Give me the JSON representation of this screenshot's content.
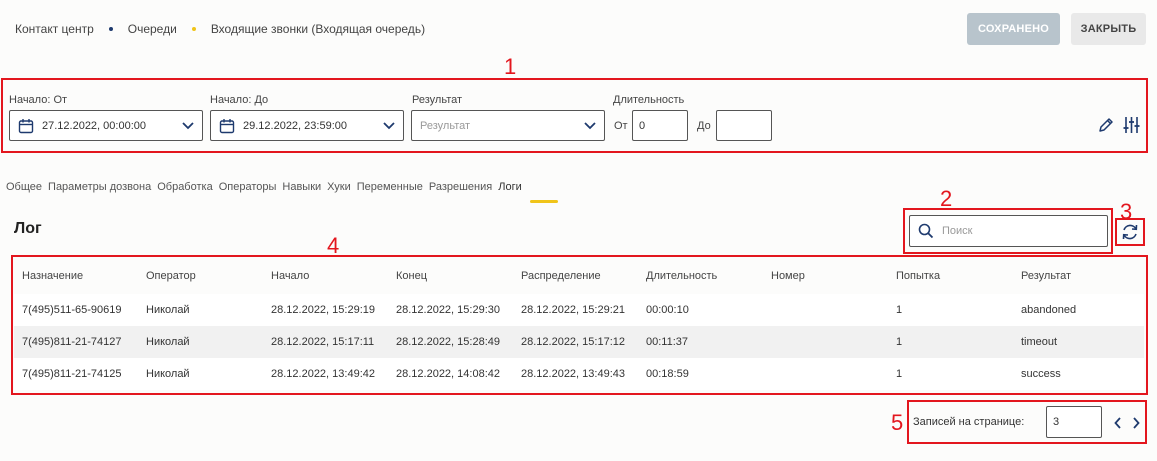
{
  "breadcrumb": {
    "items": [
      "Контакт центр",
      "Очереди",
      "Входящие звонки (Входящая очередь)"
    ],
    "sep_colors": [
      "#1e3a6e",
      "#f0c419"
    ]
  },
  "toolbar": {
    "saved_label": "СОХРАНЕНО",
    "close_label": "ЗАКРЫТЬ"
  },
  "annotations": [
    "1",
    "2",
    "3",
    "4",
    "5"
  ],
  "filters": {
    "start_from_label": "Начало: От",
    "start_from_value": "27.12.2022, 00:00:00",
    "start_to_label": "Начало: До",
    "start_to_value": "29.12.2022, 23:59:00",
    "result_label": "Результат",
    "result_placeholder": "Результат",
    "duration_label": "Длительность",
    "from_label": "От",
    "from_value": "0",
    "to_label": "До",
    "to_value": ""
  },
  "tabs": [
    "Общее",
    "Параметры дозвона",
    "Обработка",
    "Операторы",
    "Навыки",
    "Хуки",
    "Переменные",
    "Разрешения",
    "Логи"
  ],
  "log": {
    "title": "Лог",
    "search_placeholder": "Поиск",
    "columns": [
      "Назначение",
      "Оператор",
      "Начало",
      "Конец",
      "Распределение",
      "Длительность",
      "Номер",
      "Попытка",
      "Результат"
    ],
    "rows": [
      [
        "7(495)511-65-90619",
        "Николай",
        "28.12.2022, 15:29:19",
        "28.12.2022, 15:29:30",
        "28.12.2022, 15:29:21",
        "00:00:10",
        "",
        "1",
        "abandoned"
      ],
      [
        "7(495)811-21-74127",
        "Николай",
        "28.12.2022, 15:17:11",
        "28.12.2022, 15:28:49",
        "28.12.2022, 15:17:12",
        "00:11:37",
        "",
        "1",
        "timeout"
      ],
      [
        "7(495)811-21-74125",
        "Николай",
        "28.12.2022, 13:49:42",
        "28.12.2022, 14:08:42",
        "28.12.2022, 13:49:43",
        "00:18:59",
        "",
        "1",
        "success"
      ]
    ]
  },
  "pagination": {
    "label": "Записей на странице:",
    "value": "3"
  }
}
